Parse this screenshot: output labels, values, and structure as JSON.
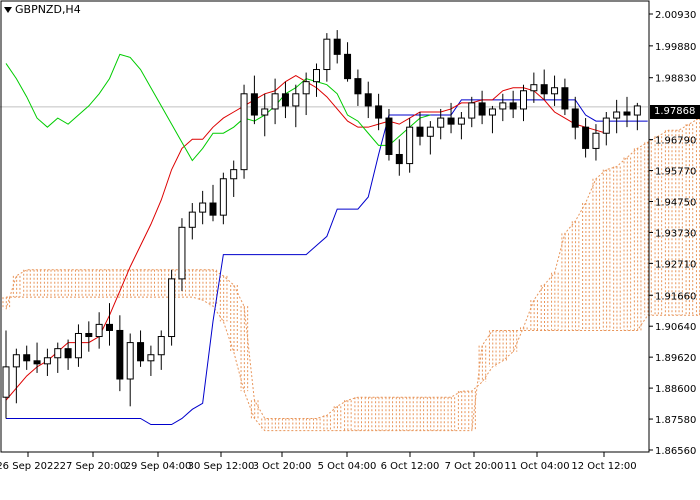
{
  "symbol_label": "GBPNZD,H4",
  "current_price": "1.97868",
  "colors": {
    "bull": "#ffffff",
    "bear": "#000000",
    "tenkan": "#dd0000",
    "kijun": "#0000cc",
    "chikou": "#00cc00",
    "cloud": "#e8955a",
    "current_line": "#c0c0c0"
  },
  "chart_data": {
    "type": "candlestick",
    "indicator": "Ichimoku",
    "ylim": [
      1.8656,
      2.0093
    ],
    "y_ticks": [
      "2.00930",
      "1.99880",
      "1.98830",
      "1.97868",
      "1.96790",
      "1.95770",
      "1.94750",
      "1.93730",
      "1.92710",
      "1.91660",
      "1.90640",
      "1.89620",
      "1.88600",
      "1.87580",
      "1.86560"
    ],
    "x_ticks": [
      "26 Sep 2022",
      "27 Sep 20:00",
      "29 Sep 04:00",
      "30 Sep 12:00",
      "3 Oct 20:00",
      "5 Oct 04:00",
      "6 Oct 12:00",
      "7 Oct 20:00",
      "11 Oct 04:00",
      "12 Oct 12:00"
    ],
    "candles": [
      [
        1.883,
        1.905,
        1.876,
        1.893
      ],
      [
        1.893,
        1.899,
        1.881,
        1.897
      ],
      [
        1.897,
        1.9,
        1.892,
        1.895
      ],
      [
        1.895,
        1.901,
        1.891,
        1.894
      ],
      [
        1.894,
        1.899,
        1.89,
        1.896
      ],
      [
        1.896,
        1.901,
        1.891,
        1.899
      ],
      [
        1.899,
        1.902,
        1.892,
        1.896
      ],
      [
        1.896,
        1.907,
        1.893,
        1.904
      ],
      [
        1.904,
        1.908,
        1.898,
        1.903
      ],
      [
        1.903,
        1.911,
        1.899,
        1.907
      ],
      [
        1.907,
        1.914,
        1.9,
        1.905
      ],
      [
        1.905,
        1.91,
        1.885,
        1.889
      ],
      [
        1.889,
        1.904,
        1.88,
        1.901
      ],
      [
        1.901,
        1.905,
        1.893,
        1.895
      ],
      [
        1.895,
        1.9,
        1.89,
        1.897
      ],
      [
        1.897,
        1.905,
        1.892,
        1.903
      ],
      [
        1.903,
        1.925,
        1.9,
        1.922
      ],
      [
        1.922,
        1.942,
        1.918,
        1.939
      ],
      [
        1.939,
        1.947,
        1.935,
        1.944
      ],
      [
        1.944,
        1.951,
        1.94,
        1.947
      ],
      [
        1.947,
        1.953,
        1.941,
        1.943
      ],
      [
        1.943,
        1.957,
        1.94,
        1.955
      ],
      [
        1.955,
        1.961,
        1.949,
        1.958
      ],
      [
        1.958,
        1.986,
        1.955,
        1.983
      ],
      [
        1.983,
        1.989,
        1.973,
        1.976
      ],
      [
        1.976,
        1.983,
        1.969,
        1.978
      ],
      [
        1.978,
        1.988,
        1.973,
        1.983
      ],
      [
        1.983,
        1.987,
        1.975,
        1.979
      ],
      [
        1.979,
        1.986,
        1.972,
        1.983
      ],
      [
        1.983,
        1.99,
        1.976,
        1.987
      ],
      [
        1.987,
        1.993,
        1.982,
        1.991
      ],
      [
        1.991,
        2.003,
        1.987,
        2.001
      ],
      [
        2.001,
        2.004,
        1.993,
        1.996
      ],
      [
        1.996,
        2.0,
        1.987,
        1.988
      ],
      [
        1.988,
        1.991,
        1.979,
        1.983
      ],
      [
        1.983,
        1.987,
        1.975,
        1.979
      ],
      [
        1.979,
        1.983,
        1.971,
        1.975
      ],
      [
        1.975,
        1.978,
        1.961,
        1.963
      ],
      [
        1.963,
        1.968,
        1.956,
        1.96
      ],
      [
        1.96,
        1.975,
        1.957,
        1.972
      ],
      [
        1.972,
        1.977,
        1.966,
        1.969
      ],
      [
        1.969,
        1.974,
        1.963,
        1.972
      ],
      [
        1.972,
        1.978,
        1.968,
        1.975
      ],
      [
        1.975,
        1.98,
        1.97,
        1.973
      ],
      [
        1.973,
        1.977,
        1.968,
        1.975
      ],
      [
        1.975,
        1.982,
        1.972,
        1.98
      ],
      [
        1.98,
        1.984,
        1.973,
        1.976
      ],
      [
        1.976,
        1.979,
        1.97,
        1.978
      ],
      [
        1.978,
        1.983,
        1.974,
        1.98
      ],
      [
        1.98,
        1.984,
        1.975,
        1.978
      ],
      [
        1.978,
        1.986,
        1.974,
        1.984
      ],
      [
        1.984,
        1.99,
        1.98,
        1.986
      ],
      [
        1.986,
        1.991,
        1.981,
        1.983
      ],
      [
        1.983,
        1.989,
        1.979,
        1.985
      ],
      [
        1.985,
        1.988,
        1.976,
        1.978
      ],
      [
        1.978,
        1.982,
        1.968,
        1.972
      ],
      [
        1.972,
        1.975,
        1.962,
        1.965
      ],
      [
        1.965,
        1.973,
        1.961,
        1.97
      ],
      [
        1.97,
        1.977,
        1.966,
        1.975
      ],
      [
        1.975,
        1.981,
        1.97,
        1.977
      ],
      [
        1.977,
        1.982,
        1.972,
        1.976
      ],
      [
        1.976,
        1.98,
        1.971,
        1.979
      ]
    ],
    "tenkan": [
      1.882,
      1.886,
      1.89,
      1.893,
      1.895,
      1.898,
      1.901,
      1.901,
      1.901,
      1.903,
      1.91,
      1.918,
      1.926,
      1.933,
      1.94,
      1.948,
      1.958,
      1.965,
      1.968,
      1.968,
      1.972,
      1.975,
      1.977,
      1.979,
      1.981,
      1.983,
      1.984,
      1.987,
      1.989,
      1.987,
      1.985,
      1.982,
      1.978,
      1.974,
      1.972,
      1.972,
      1.973,
      1.974,
      1.973,
      1.975,
      1.977,
      1.977,
      1.977,
      1.978,
      1.98,
      1.98,
      1.981,
      1.981,
      1.984,
      1.985,
      1.985,
      1.984,
      1.981,
      1.977,
      1.975,
      1.973,
      1.972,
      1.971,
      1.97
    ],
    "kijun": [
      1.876,
      1.876,
      1.876,
      1.876,
      1.876,
      1.876,
      1.876,
      1.876,
      1.876,
      1.876,
      1.876,
      1.876,
      1.876,
      1.876,
      1.874,
      1.874,
      1.874,
      1.876,
      1.879,
      1.881,
      1.908,
      1.93,
      1.93,
      1.93,
      1.93,
      1.93,
      1.93,
      1.93,
      1.93,
      1.93,
      1.933,
      1.936,
      1.945,
      1.945,
      1.945,
      1.949,
      1.963,
      1.976,
      1.976,
      1.976,
      1.976,
      1.976,
      1.976,
      1.976,
      1.981,
      1.981,
      1.981,
      1.981,
      1.981,
      1.981,
      1.981,
      1.981,
      1.981,
      1.981,
      1.981,
      1.981,
      1.976,
      1.974,
      1.974,
      1.974,
      1.974,
      1.974,
      1.974
    ],
    "chikou": [
      1.993,
      1.988,
      1.982,
      1.975,
      1.972,
      1.975,
      1.973,
      1.976,
      1.979,
      1.983,
      1.988,
      1.996,
      1.995,
      1.991,
      1.985,
      1.979,
      1.973,
      1.967,
      1.961,
      1.965,
      1.97,
      1.97,
      1.972,
      1.975,
      1.974,
      1.976,
      1.979,
      1.983,
      1.985,
      1.988,
      1.987,
      1.986,
      1.983,
      1.976,
      1.974,
      1.97,
      1.966,
      1.966,
      1.969,
      1.972,
      1.975,
      1.976
    ],
    "span_a": [
      1.912,
      1.923,
      1.925,
      1.925,
      1.925,
      1.925,
      1.925,
      1.925,
      1.925,
      1.925,
      1.925,
      1.925,
      1.925,
      1.925,
      1.925,
      1.925,
      1.925,
      1.925,
      1.925,
      1.925,
      1.925,
      1.923,
      1.92,
      1.913,
      1.882,
      1.876,
      1.876,
      1.876,
      1.876,
      1.876,
      1.876,
      1.877,
      1.88,
      1.882,
      1.883,
      1.883,
      1.883,
      1.883,
      1.883,
      1.883,
      1.883,
      1.883,
      1.883,
      1.883,
      1.885,
      1.885,
      1.888,
      1.893,
      1.895,
      1.898,
      1.906,
      1.915,
      1.92,
      1.924,
      1.937,
      1.941,
      1.947,
      1.955,
      1.958,
      1.959,
      1.962,
      1.965,
      1.967,
      1.969,
      1.971,
      1.971,
      1.973,
      1.975,
      1.976,
      1.977,
      1.977,
      1.978
    ],
    "span_b": [
      1.916,
      1.916,
      1.916,
      1.916,
      1.916,
      1.916,
      1.916,
      1.916,
      1.916,
      1.916,
      1.916,
      1.916,
      1.916,
      1.916,
      1.916,
      1.916,
      1.916,
      1.916,
      1.916,
      1.915,
      1.913,
      1.908,
      1.898,
      1.885,
      1.876,
      1.872,
      1.872,
      1.872,
      1.872,
      1.872,
      1.872,
      1.872,
      1.872,
      1.872,
      1.872,
      1.872,
      1.872,
      1.872,
      1.872,
      1.872,
      1.872,
      1.872,
      1.872,
      1.872,
      1.872,
      1.872,
      1.9,
      1.905,
      1.905,
      1.905,
      1.905,
      1.905,
      1.905,
      1.905,
      1.905,
      1.905,
      1.905,
      1.905,
      1.905,
      1.905,
      1.905,
      1.905,
      1.91,
      1.91,
      1.91,
      1.91,
      1.91,
      1.91,
      1.936,
      1.94,
      1.941,
      1.941
    ]
  }
}
